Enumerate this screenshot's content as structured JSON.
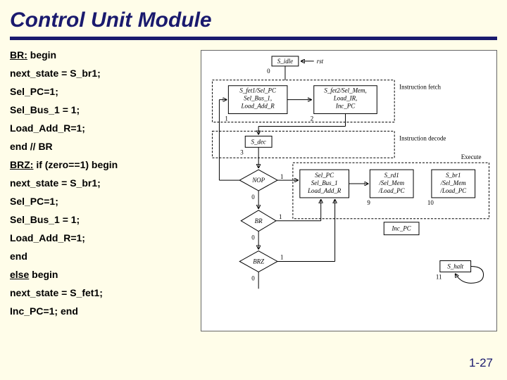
{
  "title": "Control Unit Module",
  "code": {
    "l1a": "BR:",
    "l1b": " begin",
    "l2": "next_state = S_br1;",
    "l3": "Sel_PC=1;",
    "l4": "Sel_Bus_1 = 1;",
    "l5": "Load_Add_R=1;",
    "l6": "end     //  BR",
    "l7a": "BRZ:",
    "l7b": " if (zero==1) begin",
    "l8": "next_state = S_br1;",
    "l9": "Sel_PC=1;",
    "l10": "Sel_Bus_1 = 1;",
    "l11": "Load_Add_R=1;",
    "l12": "end",
    "l13a": "else",
    "l13b": " begin",
    "l14": " next_state = S_fet1;",
    "l15": " Inc_PC=1; end"
  },
  "diagram": {
    "s_idle": "S_idle",
    "rst": "rst",
    "s_idle_n": "0",
    "instr_fetch": "Instruction fetch",
    "s_fet1": "S_fet1/Sel_PC\nSel_Bus_1,\nLoad_Add_R",
    "s_fet1_n": "1",
    "s_fet2": "S_fet2/Sel_Mem,\nLoad_IR,\nInc_PC",
    "s_fet2_n": "2",
    "instr_decode": "Instruction decode",
    "s_dec": "S_dec",
    "s_dec_n": "3",
    "nop": "NOP",
    "exec_a": "Sel_PC\nSel_Bus_1\nLoad_Add_R",
    "s_rd1": "S_rd1\n/Sel_Mem\n/Load_PC",
    "s_rd1_n": "9",
    "s_br1": "S_br1\n/Sel_Mem\n/Load_PC",
    "s_br1_n": "10",
    "br": "BR",
    "brz": "BRZ",
    "inc_pc": "Inc_PC",
    "s_halt": "S_halt",
    "s_halt_n": "11",
    "execute": "Execute",
    "zero": "0",
    "one": "1"
  },
  "slidenum": "1-27"
}
